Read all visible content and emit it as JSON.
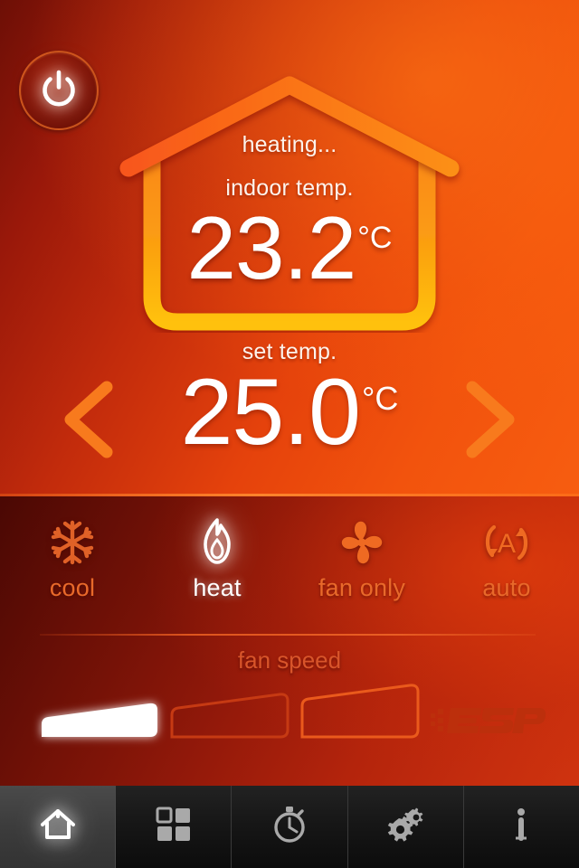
{
  "colors": {
    "hero_dark": "#6d0f06",
    "hero_bright": "#f75d10",
    "controls_dark": "#4a0804",
    "controls_bright": "#cf330f",
    "accent_orange": "#f4530c",
    "inactive_label": "#e8692a",
    "active_white": "#ffffff",
    "tabbar_bg": "#161616",
    "esp_logo": "#bc2f0c"
  },
  "power": {
    "icon": "power-icon",
    "state": "on"
  },
  "hero": {
    "status_label": "heating...",
    "indoor_label": "indoor temp.",
    "indoor_value": "23.2",
    "indoor_unit": "°C",
    "set_label": "set temp.",
    "set_value": "25.0",
    "set_unit": "°C",
    "decrease_icon": "chevron-left-icon",
    "increase_icon": "chevron-right-icon",
    "house_icon": "house-outline-icon"
  },
  "modes": {
    "items": [
      {
        "label": "cool",
        "icon": "snowflake-icon",
        "active": false
      },
      {
        "label": "heat",
        "icon": "flame-icon",
        "active": true
      },
      {
        "label": "fan only",
        "icon": "fan-icon",
        "active": false
      },
      {
        "label": "auto",
        "icon": "auto-cycle-icon",
        "active": false
      }
    ]
  },
  "fan_speed": {
    "label": "fan speed",
    "levels": [
      {
        "level": 1,
        "active": true
      },
      {
        "level": 2,
        "active": false
      },
      {
        "level": 3,
        "active": false
      }
    ],
    "selected": 1
  },
  "branding": {
    "logo_text": "ESP",
    "logo_icon": "esp-logo-icon"
  },
  "tabbar": {
    "items": [
      {
        "name": "home",
        "icon": "home-icon",
        "active": true
      },
      {
        "name": "zones",
        "icon": "grid-icon",
        "active": false
      },
      {
        "name": "timer",
        "icon": "stopwatch-icon",
        "active": false
      },
      {
        "name": "settings",
        "icon": "gears-icon",
        "active": false
      },
      {
        "name": "info",
        "icon": "info-icon",
        "active": false
      }
    ]
  }
}
